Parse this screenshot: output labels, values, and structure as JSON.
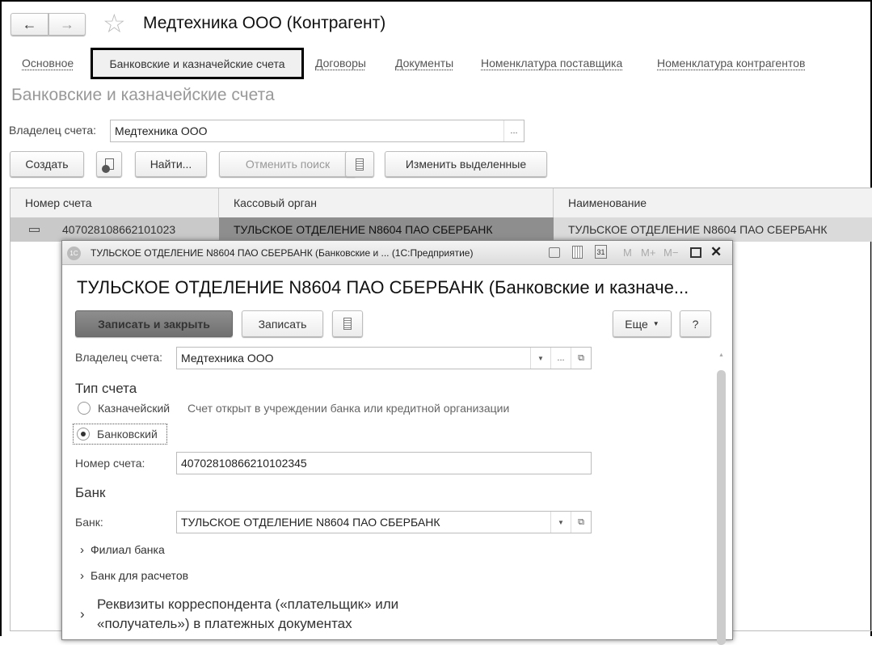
{
  "header": {
    "title": "Медтехника ООО (Контрагент)",
    "back": "←",
    "forward": "→",
    "star": "☆"
  },
  "tabs": [
    "Основное",
    "Банковские и казначейские счета",
    "Договоры",
    "Документы",
    "Номенклатура поставщика",
    "Номенклатура контрагентов"
  ],
  "section_title": "Банковские и казначейские счета",
  "owner": {
    "label": "Владелец счета:",
    "value": "Медтехника ООО",
    "select": "..."
  },
  "toolbar": {
    "create": "Создать",
    "find": "Найти...",
    "cancel_search": "Отменить поиск",
    "edit_selected": "Изменить выделенные"
  },
  "table": {
    "columns": [
      "Номер счета",
      "Кассовый орган",
      "Наименование"
    ],
    "rows": [
      {
        "number": "407028108662101023",
        "cash": "ТУЛЬСКОЕ ОТДЕЛЕНИЕ N8604 ПАО СБЕРБАНК",
        "name": "ТУЛЬСКОЕ ОТДЕЛЕНИЕ N8604 ПАО СБЕРБАНК"
      }
    ]
  },
  "modal": {
    "window_title": "ТУЛЬСКОЕ ОТДЕЛЕНИЕ N8604 ПАО СБЕРБАНК (Банковские и ... (1С:Предприятие)",
    "logo": "1С",
    "titlebar_buttons": {
      "m": "M",
      "mplus": "M+",
      "mminus": "M−",
      "calendar": "31",
      "close": "✕"
    },
    "title": "ТУЛЬСКОЕ ОТДЕЛЕНИЕ N8604 ПАО СБЕРБАНК (Банковские и казначе...",
    "save_close": "Записать и закрыть",
    "save": "Записать",
    "more": "Еще",
    "help": "?",
    "owner_label": "Владелец счета:",
    "owner_value": "Медтехника ООО",
    "ellipsis": "...",
    "account_type_heading": "Тип счета",
    "treasury": "Казначейский",
    "treasury_hint": "Счет открыт в учреждении банка или кредитной организации",
    "bank_type": "Банковский",
    "selected_type": "Банковский",
    "number_label": "Номер счета:",
    "number_value": "40702810866210102345",
    "bank_heading": "Банк",
    "bank_label": "Банк:",
    "bank_value": "ТУЛЬСКОЕ ОТДЕЛЕНИЕ N8604 ПАО СБЕРБАНК",
    "branch": "Филиал банка",
    "settlement_bank": "Банк для расчетов",
    "correspondent_1": "Реквизиты корреспондента («плательщик» или",
    "correspondent_2": "«получатель») в платежных документах"
  }
}
